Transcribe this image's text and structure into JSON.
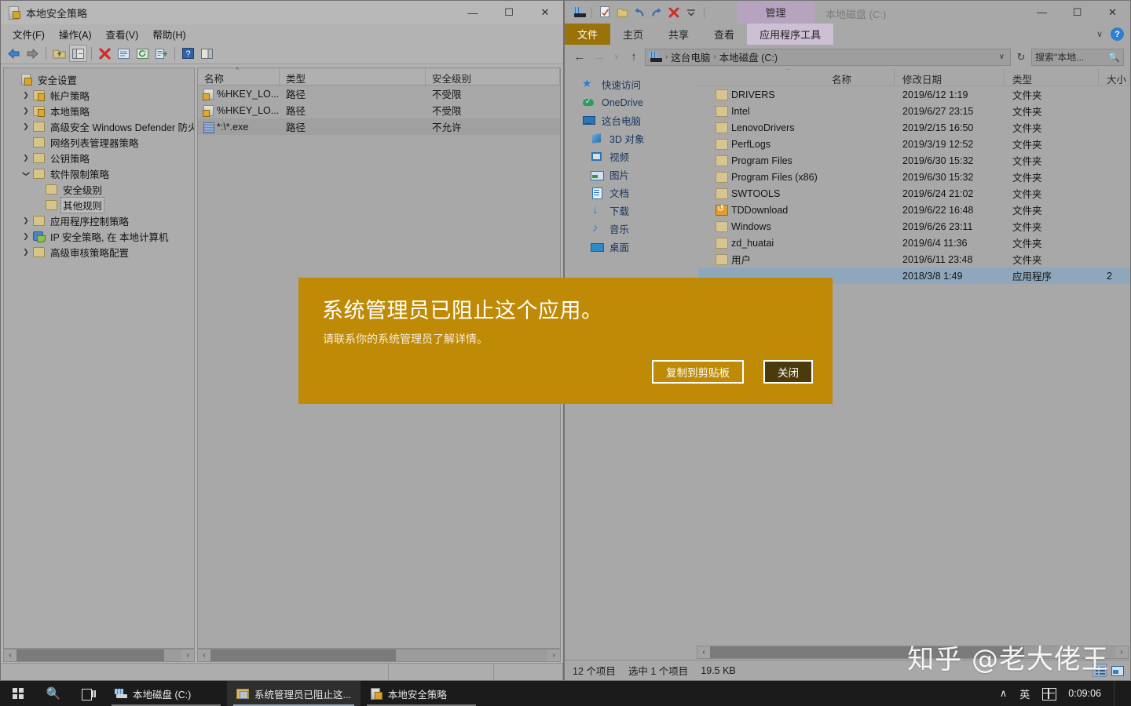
{
  "secpol": {
    "title": "本地安全策略",
    "window_buttons": {
      "minimize": "—",
      "maximize": "☐",
      "close": "✕"
    },
    "menus": [
      "文件(F)",
      "操作(A)",
      "查看(V)",
      "帮助(H)"
    ],
    "toolbar_icons": [
      "back-icon",
      "forward-icon",
      "up-folder-icon",
      "show-hide-tree-icon",
      "delete-icon",
      "properties-icon",
      "refresh-icon",
      "export-list-icon",
      "help-icon",
      "show-pane-icon"
    ],
    "tree": [
      {
        "label": "安全设置",
        "icon": "security-settings-icon",
        "depth": 0,
        "expander": "",
        "selected": false
      },
      {
        "label": "帐户策略",
        "icon": "folder-locked-icon",
        "depth": 1,
        "expander": "collapsed",
        "selected": false
      },
      {
        "label": "本地策略",
        "icon": "folder-locked-icon",
        "depth": 1,
        "expander": "collapsed",
        "selected": false
      },
      {
        "label": "高级安全 Windows Defender 防火墙",
        "icon": "folder-icon",
        "depth": 1,
        "expander": "collapsed",
        "selected": false
      },
      {
        "label": "网络列表管理器策略",
        "icon": "folder-icon",
        "depth": 1,
        "expander": "none",
        "selected": false
      },
      {
        "label": "公钥策略",
        "icon": "folder-icon",
        "depth": 1,
        "expander": "collapsed",
        "selected": false
      },
      {
        "label": "软件限制策略",
        "icon": "folder-icon",
        "depth": 1,
        "expander": "expanded",
        "selected": false
      },
      {
        "label": "安全级别",
        "icon": "folder-icon",
        "depth": 2,
        "expander": "none",
        "selected": false
      },
      {
        "label": "其他规则",
        "icon": "folder-icon",
        "depth": 2,
        "expander": "none",
        "selected": true
      },
      {
        "label": "应用程序控制策略",
        "icon": "folder-icon",
        "depth": 1,
        "expander": "collapsed",
        "selected": false
      },
      {
        "label": "IP 安全策略, 在 本地计算机",
        "icon": "ip-security-icon",
        "depth": 1,
        "expander": "collapsed",
        "selected": false
      },
      {
        "label": "高级审核策略配置",
        "icon": "folder-icon",
        "depth": 1,
        "expander": "collapsed",
        "selected": false
      }
    ],
    "list_columns": [
      "名称",
      "类型",
      "安全级别"
    ],
    "list_rows": [
      {
        "name": "%HKEY_LO...",
        "type": "路径",
        "level": "不受限",
        "icon": "registry-rule-icon",
        "selected": false
      },
      {
        "name": "%HKEY_LO...",
        "type": "路径",
        "level": "不受限",
        "icon": "registry-rule-icon",
        "selected": false
      },
      {
        "name": "*:\\*.exe",
        "type": "路径",
        "level": "不允许",
        "icon": "path-rule-icon",
        "selected": true
      }
    ]
  },
  "explorer": {
    "title": "本地磁盘 (C:)",
    "quick_access_toolbar": [
      "this-pc-icon",
      "properties-icon",
      "new-folder-icon",
      "undo-icon",
      "redo-icon",
      "delete-icon",
      "customize-dropdown-icon"
    ],
    "contextual_tab_group": "管理",
    "tabs": [
      {
        "label": "文件",
        "kind": "file"
      },
      {
        "label": "主页",
        "kind": "normal"
      },
      {
        "label": "共享",
        "kind": "normal"
      },
      {
        "label": "查看",
        "kind": "normal"
      },
      {
        "label": "应用程序工具",
        "kind": "contextual"
      }
    ],
    "window_buttons": {
      "minimize": "—",
      "maximize": "☐",
      "close": "✕"
    },
    "ribbon_collapse_icon": "chevron-down-icon",
    "help_icon": "help-icon",
    "breadcrumb": [
      "这台电脑",
      "本地磁盘 (C:)"
    ],
    "breadcrumb_separator": "›",
    "search_placeholder": "搜索\"本地...",
    "nav_pane": [
      {
        "label": "快速访问",
        "icon": "pin-icon",
        "indent": false
      },
      {
        "label": "OneDrive",
        "icon": "onedrive-icon",
        "indent": false
      },
      {
        "label": "这台电脑",
        "icon": "this-pc-icon",
        "indent": false
      },
      {
        "label": "3D 对象",
        "icon": "3d-objects-icon",
        "indent": true
      },
      {
        "label": "视频",
        "icon": "videos-icon",
        "indent": true
      },
      {
        "label": "图片",
        "icon": "pictures-icon",
        "indent": true
      },
      {
        "label": "文档",
        "icon": "documents-icon",
        "indent": true
      },
      {
        "label": "下载",
        "icon": "downloads-icon",
        "indent": true
      },
      {
        "label": "音乐",
        "icon": "music-icon",
        "indent": true
      },
      {
        "label": "桌面",
        "icon": "desktop-icon",
        "indent": true
      }
    ],
    "columns": [
      "名称",
      "修改日期",
      "类型",
      "大小"
    ],
    "rows": [
      {
        "name": "DRIVERS",
        "date": "2019/6/12 1:19",
        "type": "文件夹",
        "size": "",
        "icon": "folder-icon",
        "selected": false
      },
      {
        "name": "Intel",
        "date": "2019/6/27 23:15",
        "type": "文件夹",
        "size": "",
        "icon": "folder-icon",
        "selected": false
      },
      {
        "name": "LenovoDrivers",
        "date": "2019/2/15 16:50",
        "type": "文件夹",
        "size": "",
        "icon": "folder-icon",
        "selected": false
      },
      {
        "name": "PerfLogs",
        "date": "2019/3/19 12:52",
        "type": "文件夹",
        "size": "",
        "icon": "folder-icon",
        "selected": false
      },
      {
        "name": "Program Files",
        "date": "2019/6/30 15:32",
        "type": "文件夹",
        "size": "",
        "icon": "folder-icon",
        "selected": false
      },
      {
        "name": "Program Files (x86)",
        "date": "2019/6/30 15:32",
        "type": "文件夹",
        "size": "",
        "icon": "folder-icon",
        "selected": false
      },
      {
        "name": "SWTOOLS",
        "date": "2019/6/24 21:02",
        "type": "文件夹",
        "size": "",
        "icon": "folder-icon",
        "selected": false
      },
      {
        "name": "TDDownload",
        "date": "2019/6/22 16:48",
        "type": "文件夹",
        "size": "",
        "icon": "folder-download-icon",
        "selected": false
      },
      {
        "name": "Windows",
        "date": "2019/6/26 23:11",
        "type": "文件夹",
        "size": "",
        "icon": "folder-icon",
        "selected": false
      },
      {
        "name": "zd_huatai",
        "date": "2019/6/4 11:36",
        "type": "文件夹",
        "size": "",
        "icon": "folder-icon",
        "selected": false
      },
      {
        "name": "用户",
        "date": "2019/6/11 23:48",
        "type": "文件夹",
        "size": "",
        "icon": "folder-icon",
        "selected": false
      },
      {
        "name": "",
        "date": "2018/3/8 1:49",
        "type": "应用程序",
        "size": "2",
        "icon": "application-icon",
        "selected": true
      }
    ],
    "status": {
      "item_count": "12 个项目",
      "selection": "选中 1 个项目",
      "size": "19.5 KB"
    },
    "view_buttons": [
      "details-view-icon",
      "large-icons-view-icon"
    ]
  },
  "dialog": {
    "title": "系统管理员已阻止这个应用。",
    "message": "请联系你的系统管理员了解详情。",
    "buttons": [
      {
        "label": "复制到剪贴板",
        "style": "outline"
      },
      {
        "label": "关闭",
        "style": "dark"
      }
    ],
    "background_color": "#bf8a05"
  },
  "taskbar": {
    "start_icon": "windows-start-icon",
    "search_icon": "search-icon",
    "task_view_icon": "task-view-icon",
    "tasks": [
      {
        "label": "本地磁盘 (C:)",
        "icon": "drive-icon",
        "active": false
      },
      {
        "label": "系统管理员已阻止这...",
        "icon": "blocked-app-icon",
        "active": true
      },
      {
        "label": "本地安全策略",
        "icon": "secpol-icon",
        "active": false
      }
    ],
    "tray": {
      "chevron": "∧",
      "ime_lang": "英",
      "ime_mode_icon": "pinyin-icon",
      "clock": "0:09:06"
    }
  },
  "watermark": {
    "text": "知乎 @老大佬王"
  }
}
